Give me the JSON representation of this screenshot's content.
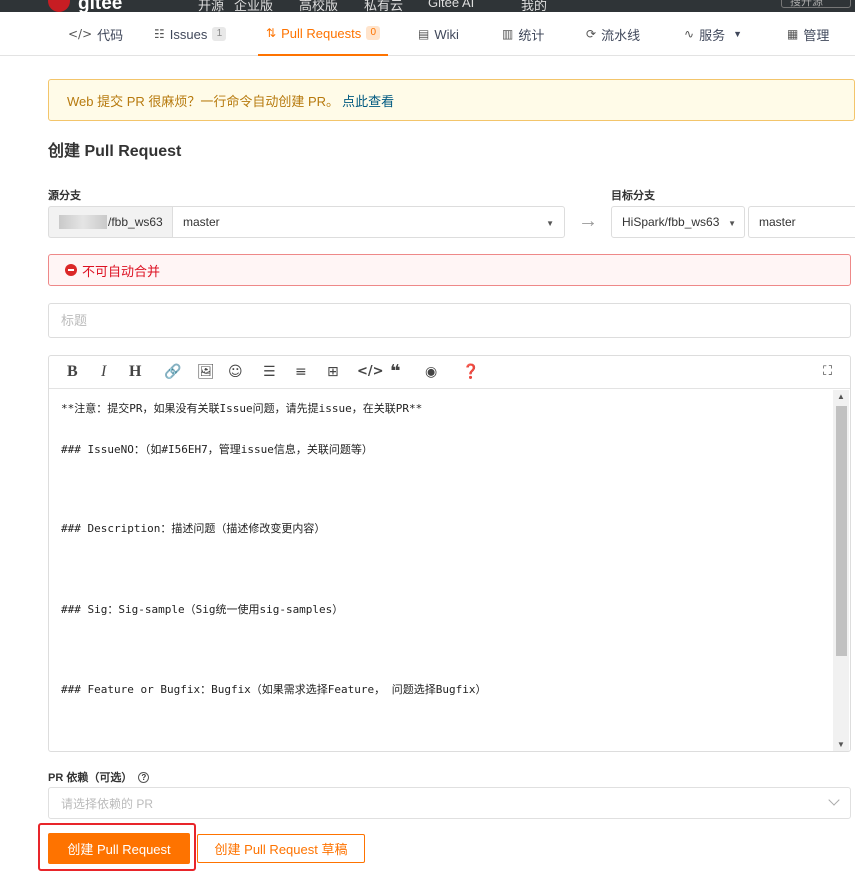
{
  "topbar": {
    "logo_text": "gitee",
    "nav": [
      "开源",
      "企业版",
      "高校版",
      "私有云",
      "Gitee AI",
      "我的"
    ],
    "search_placeholder": "搜开源"
  },
  "tabs": [
    {
      "icon": "</>",
      "label": "代码"
    },
    {
      "icon": "☷",
      "label": "Issues",
      "count": "1"
    },
    {
      "icon": "⇅",
      "label": "Pull Requests",
      "count": "0"
    },
    {
      "icon": "▤",
      "label": "Wiki"
    },
    {
      "icon": "▥",
      "label": "统计"
    },
    {
      "icon": "⟳",
      "label": "流水线"
    },
    {
      "icon": "∿",
      "label": "服务"
    },
    {
      "icon": "▦",
      "label": "管理"
    }
  ],
  "notice": {
    "text": "Web 提交 PR 很麻烦？一行命令自动创建 PR。",
    "link": "点此查看"
  },
  "page_title": "创建 Pull Request",
  "source": {
    "label": "源分支",
    "repo_suffix": "/fbb_ws63",
    "branch": "master"
  },
  "target": {
    "label": "目标分支",
    "repo": "HiSpark/fbb_ws63",
    "branch": "master"
  },
  "error_text": "不可自动合并",
  "title_placeholder": "标题",
  "editor_lines": [
    "**注意：提交PR，如果没有关联Issue问题，请先提issue，在关联PR**",
    "### IssueNO：（如#I56EH7，管理issue信息，关联问题等）",
    "### Description：描述问题（描述修改变更内容）",
    "### Sig：Sig-sample（Sig统一使用sig-samples）",
    "### Feature or Bugfix：Bugfix（如果需求选择Feature， 问题选择Bugfix）"
  ],
  "dependency": {
    "label": "PR 依赖（可选）",
    "placeholder": "请选择依赖的 PR"
  },
  "buttons": {
    "create": "创建 Pull Request",
    "draft": "创建 Pull Request 草稿"
  },
  "colors": {
    "accent": "#fe7300",
    "error": "#db2828",
    "highlight_frame": "#e8252a"
  }
}
